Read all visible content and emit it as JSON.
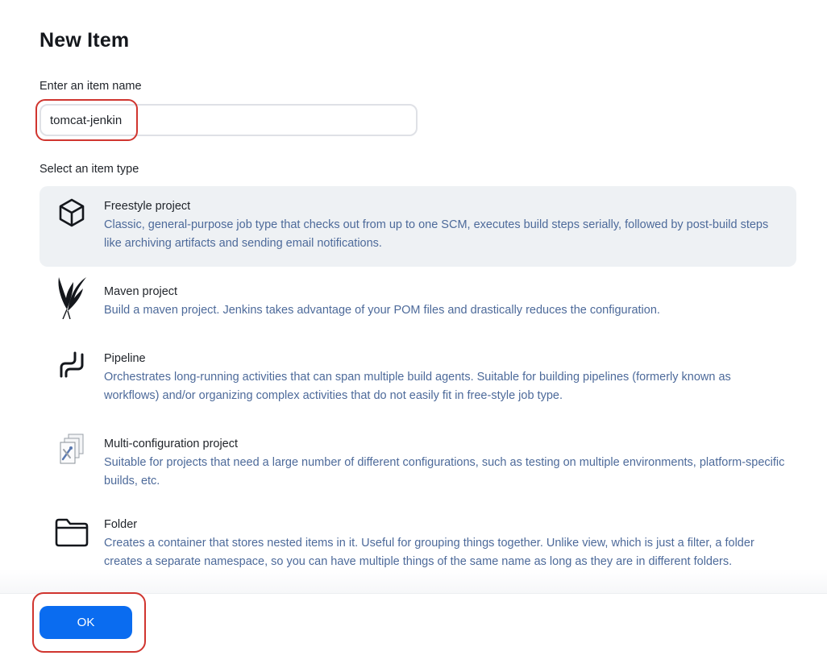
{
  "page": {
    "title": "New Item"
  },
  "name_field": {
    "label": "Enter an item name",
    "value": "tomcat-jenkin"
  },
  "type_section": {
    "label": "Select an item type"
  },
  "item_types": [
    {
      "title": "Freestyle project",
      "description": "Classic, general-purpose job type that checks out from up to one SCM, executes build steps serially, followed by post-build steps like archiving artifacts and sending email notifications.",
      "icon": "freestyle-cube-icon",
      "selected": true
    },
    {
      "title": "Maven project",
      "description": "Build a maven project. Jenkins takes advantage of your POM files and drastically reduces the configuration.",
      "icon": "maven-feather-icon",
      "selected": false
    },
    {
      "title": "Pipeline",
      "description": "Orchestrates long-running activities that can span multiple build agents. Suitable for building pipelines (formerly known as workflows) and/or organizing complex activities that do not easily fit in free-style job type.",
      "icon": "pipeline-icon",
      "selected": false
    },
    {
      "title": "Multi-configuration project",
      "description": "Suitable for projects that need a large number of different configurations, such as testing on multiple environments, platform-specific builds, etc.",
      "icon": "multi-configuration-icon",
      "selected": false
    },
    {
      "title": "Folder",
      "description": "Creates a container that stores nested items in it. Useful for grouping things together. Unlike view, which is just a filter, a folder creates a separate namespace, so you can have multiple things of the same name as long as they are in different folders.",
      "icon": "folder-icon",
      "selected": false
    }
  ],
  "actions": {
    "ok_label": "OK"
  },
  "colors": {
    "primary_button": "#0a6cf0",
    "selected_card": "#eef1f4",
    "description_text": "#4d6a9a",
    "annotation_highlight": "#d0352f"
  }
}
